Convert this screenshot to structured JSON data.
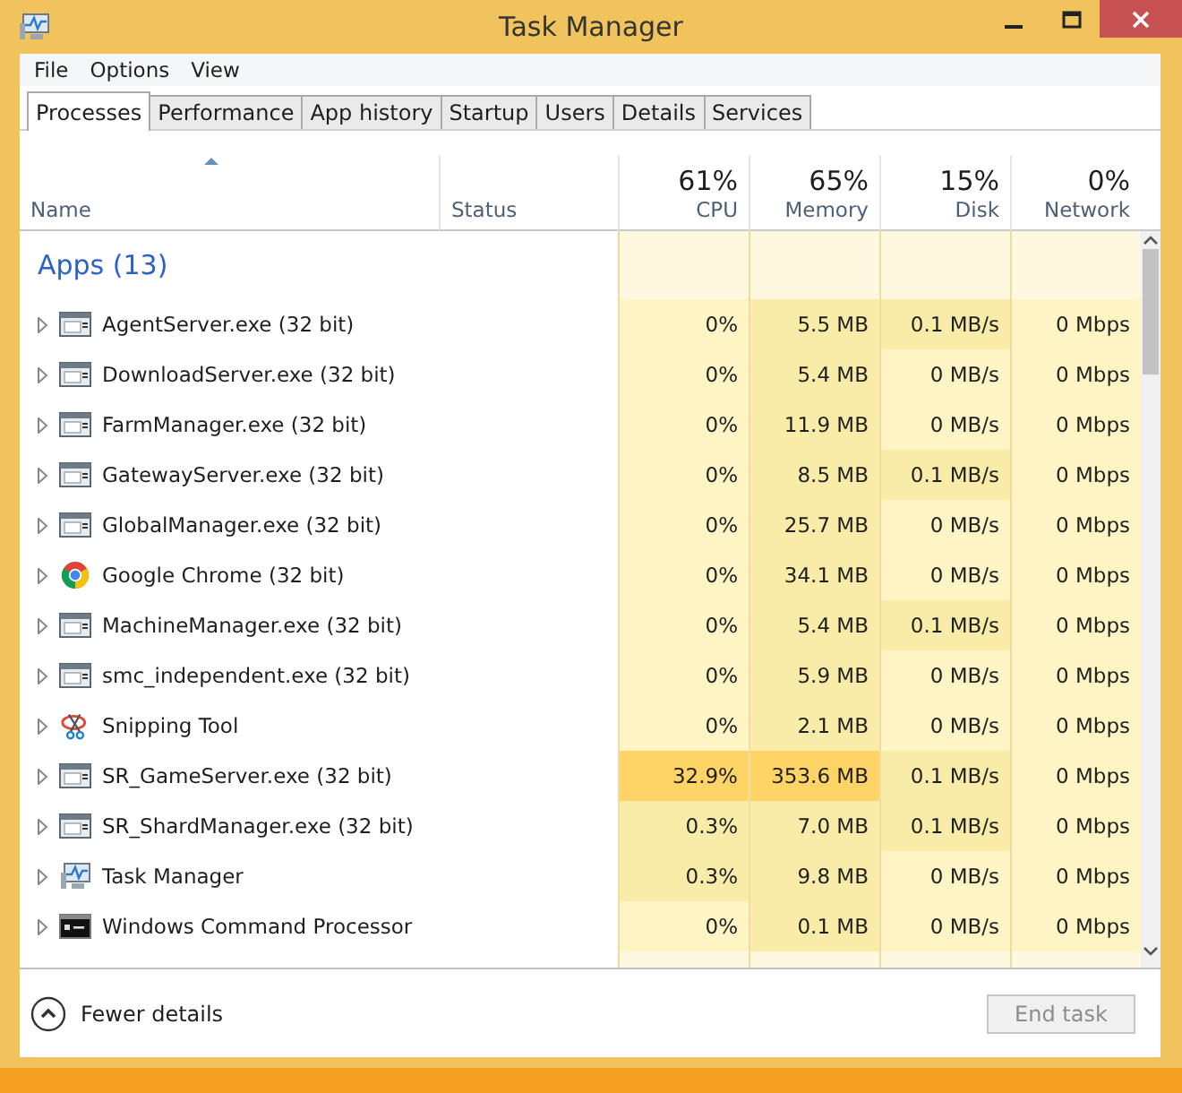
{
  "window": {
    "title": "Task Manager"
  },
  "menu": [
    "File",
    "Options",
    "View"
  ],
  "tabs": [
    {
      "label": "Processes",
      "selected": true
    },
    {
      "label": "Performance",
      "selected": false
    },
    {
      "label": "App history",
      "selected": false
    },
    {
      "label": "Startup",
      "selected": false
    },
    {
      "label": "Users",
      "selected": false
    },
    {
      "label": "Details",
      "selected": false
    },
    {
      "label": "Services",
      "selected": false
    }
  ],
  "columns": [
    {
      "label": "Name"
    },
    {
      "label": "Status"
    },
    {
      "label": "CPU",
      "total": "61%"
    },
    {
      "label": "Memory",
      "total": "65%"
    },
    {
      "label": "Disk",
      "total": "15%"
    },
    {
      "label": "Network",
      "total": "0%"
    }
  ],
  "group": {
    "title": "Apps (13)"
  },
  "rows": [
    {
      "kind": "exe",
      "name": "AgentServer.exe (32 bit)",
      "cells": [
        {
          "text": "0%",
          "color": "#fff4c4"
        },
        {
          "text": "5.5 MB",
          "color": "#f9eca8"
        },
        {
          "text": "0.1 MB/s",
          "color": "#f9eca8"
        },
        {
          "text": "0 Mbps",
          "color": "#fff4c4"
        }
      ]
    },
    {
      "kind": "exe",
      "name": "DownloadServer.exe (32 bit)",
      "cells": [
        {
          "text": "0%",
          "color": "#fff4c4"
        },
        {
          "text": "5.4 MB",
          "color": "#f9eca8"
        },
        {
          "text": "0 MB/s",
          "color": "#fff4c4"
        },
        {
          "text": "0 Mbps",
          "color": "#fff4c4"
        }
      ]
    },
    {
      "kind": "exe",
      "name": "FarmManager.exe (32 bit)",
      "cells": [
        {
          "text": "0%",
          "color": "#fff4c4"
        },
        {
          "text": "11.9 MB",
          "color": "#f9eca8"
        },
        {
          "text": "0 MB/s",
          "color": "#fff4c4"
        },
        {
          "text": "0 Mbps",
          "color": "#fff4c4"
        }
      ]
    },
    {
      "kind": "exe",
      "name": "GatewayServer.exe (32 bit)",
      "cells": [
        {
          "text": "0%",
          "color": "#fff4c4"
        },
        {
          "text": "8.5 MB",
          "color": "#f9eca8"
        },
        {
          "text": "0.1 MB/s",
          "color": "#f9eca8"
        },
        {
          "text": "0 Mbps",
          "color": "#fff4c4"
        }
      ]
    },
    {
      "kind": "exe",
      "name": "GlobalManager.exe (32 bit)",
      "cells": [
        {
          "text": "0%",
          "color": "#fff4c4"
        },
        {
          "text": "25.7 MB",
          "color": "#f9eca8"
        },
        {
          "text": "0 MB/s",
          "color": "#fff4c4"
        },
        {
          "text": "0 Mbps",
          "color": "#fff4c4"
        }
      ]
    },
    {
      "kind": "chrome",
      "name": "Google Chrome (32 bit)",
      "cells": [
        {
          "text": "0%",
          "color": "#fff4c4"
        },
        {
          "text": "34.1 MB",
          "color": "#f9eca8"
        },
        {
          "text": "0 MB/s",
          "color": "#fff4c4"
        },
        {
          "text": "0 Mbps",
          "color": "#fff4c4"
        }
      ]
    },
    {
      "kind": "exe",
      "name": "MachineManager.exe (32 bit)",
      "cells": [
        {
          "text": "0%",
          "color": "#fff4c4"
        },
        {
          "text": "5.4 MB",
          "color": "#f9eca8"
        },
        {
          "text": "0.1 MB/s",
          "color": "#f9eca8"
        },
        {
          "text": "0 Mbps",
          "color": "#fff4c4"
        }
      ]
    },
    {
      "kind": "exe",
      "name": "smc_independent.exe (32 bit)",
      "cells": [
        {
          "text": "0%",
          "color": "#fff4c4"
        },
        {
          "text": "5.9 MB",
          "color": "#f9eca8"
        },
        {
          "text": "0 MB/s",
          "color": "#fff4c4"
        },
        {
          "text": "0 Mbps",
          "color": "#fff4c4"
        }
      ]
    },
    {
      "kind": "scissors",
      "name": "Snipping Tool",
      "cells": [
        {
          "text": "0%",
          "color": "#fff4c4"
        },
        {
          "text": "2.1 MB",
          "color": "#f9eca8"
        },
        {
          "text": "0 MB/s",
          "color": "#fff4c4"
        },
        {
          "text": "0 Mbps",
          "color": "#fff4c4"
        }
      ]
    },
    {
      "kind": "exe",
      "name": "SR_GameServer.exe (32 bit)",
      "cells": [
        {
          "text": "32.9%",
          "color": "#ffd466"
        },
        {
          "text": "353.6 MB",
          "color": "#ffd466"
        },
        {
          "text": "0.1 MB/s",
          "color": "#f9eca8"
        },
        {
          "text": "0 Mbps",
          "color": "#fff4c4"
        }
      ]
    },
    {
      "kind": "exe",
      "name": "SR_ShardManager.exe (32 bit)",
      "cells": [
        {
          "text": "0.3%",
          "color": "#f9eca8"
        },
        {
          "text": "7.0 MB",
          "color": "#f9eca8"
        },
        {
          "text": "0.1 MB/s",
          "color": "#f9eca8"
        },
        {
          "text": "0 Mbps",
          "color": "#fff4c4"
        }
      ]
    },
    {
      "kind": "monitor",
      "name": "Task Manager",
      "cells": [
        {
          "text": "0.3%",
          "color": "#f9eca8"
        },
        {
          "text": "9.8 MB",
          "color": "#f9eca8"
        },
        {
          "text": "0 MB/s",
          "color": "#fff4c4"
        },
        {
          "text": "0 Mbps",
          "color": "#fff4c4"
        }
      ]
    },
    {
      "kind": "console",
      "name": "Windows Command Processor",
      "cells": [
        {
          "text": "0%",
          "color": "#fff4c4"
        },
        {
          "text": "0.1 MB",
          "color": "#f9eca8"
        },
        {
          "text": "0 MB/s",
          "color": "#fff4c4"
        },
        {
          "text": "0 Mbps",
          "color": "#fff4c4"
        }
      ]
    }
  ],
  "footer": {
    "toggle": "Fewer details",
    "button": {
      "label": "End task",
      "disabled": true
    }
  }
}
